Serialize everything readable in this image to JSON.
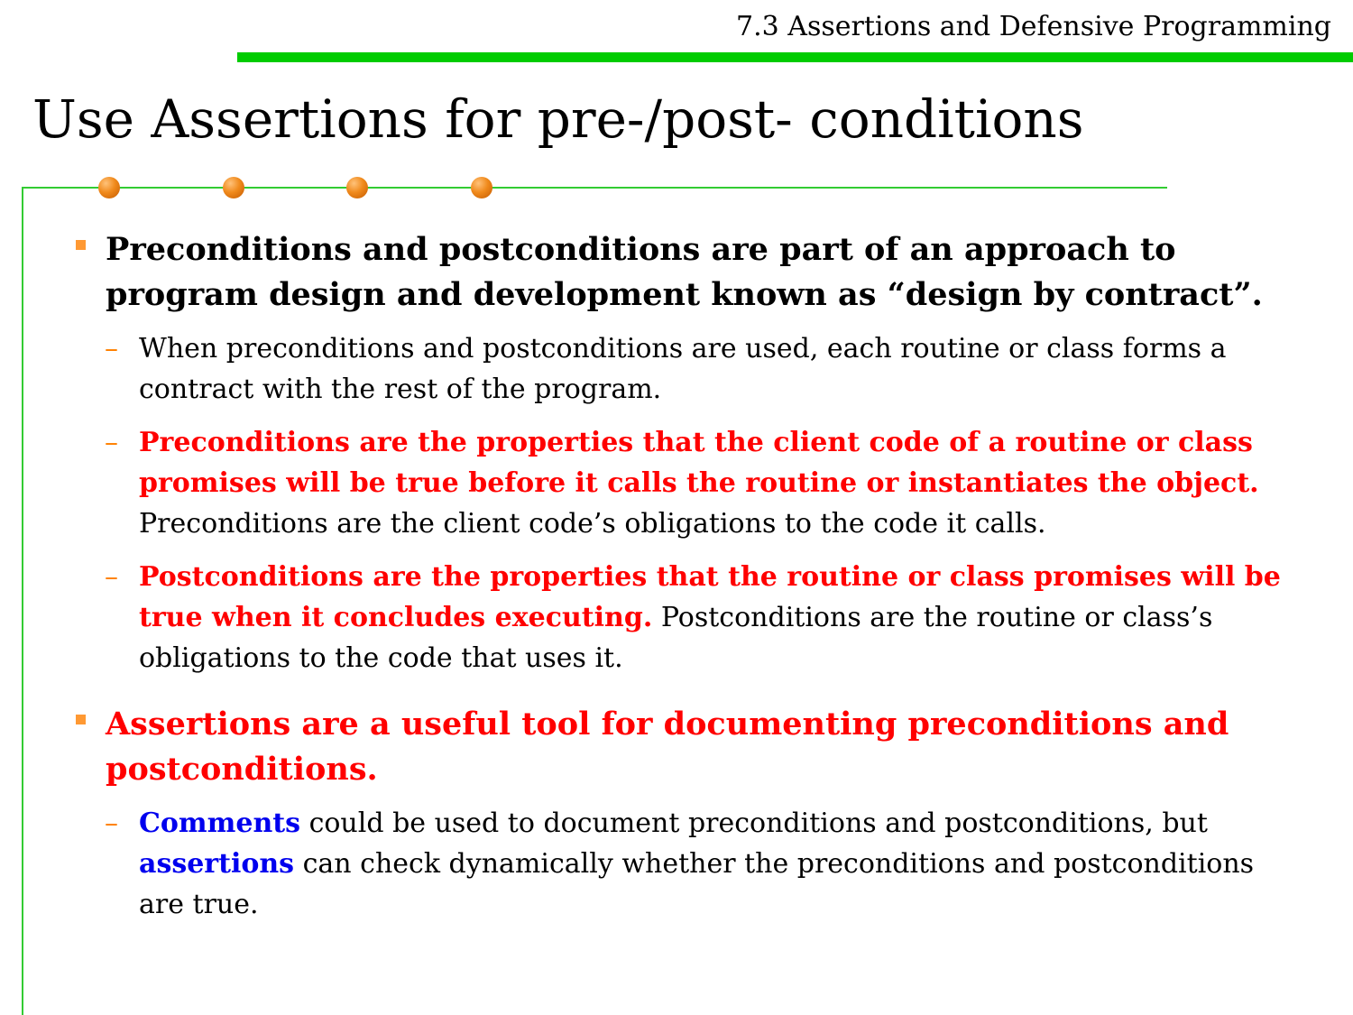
{
  "header": {
    "section_title": "7.3 Assertions and Defensive Programming",
    "accent_color": "#00cc00"
  },
  "slide": {
    "title": "Use Assertions for pre-/post- conditions"
  },
  "bullets": [
    {
      "text": "Preconditions and postconditions are part of an approach to program design and development known as “design by contract”."
    },
    {
      "text": "Assertions are a useful tool for documenting preconditions and postconditions."
    }
  ],
  "subbullets": {
    "contract": "When preconditions and postconditions are used, each routine or class forms a contract with the rest of the program.",
    "pre_red": "Preconditions are the properties that the client code of a routine or class promises will be true before it calls the routine or instantiates the object.",
    "pre_rest": " Preconditions are the client code’s obligations to the code it calls.",
    "post_red": "Postconditions are the properties that the routine or class promises will be true when it concludes executing.",
    "post_rest": " Postconditions are the routine or class’s obligations to the code that uses it.",
    "comments_word": "Comments",
    "comments_mid": " could be used to document preconditions and postconditions, but ",
    "assertions_word": "assertions",
    "comments_end": " can check dynamically whether the preconditions and postconditions are true."
  },
  "colors": {
    "emphasis_red": "#ff0000",
    "emphasis_blue": "#0000ee",
    "bullet_orange": "#ff9933",
    "frame_green": "#33cc33"
  },
  "icons": {
    "bullet": "square-bullet-icon",
    "sub_bullet": "dash-bullet-icon",
    "decoration": "orange-dot-icon"
  }
}
